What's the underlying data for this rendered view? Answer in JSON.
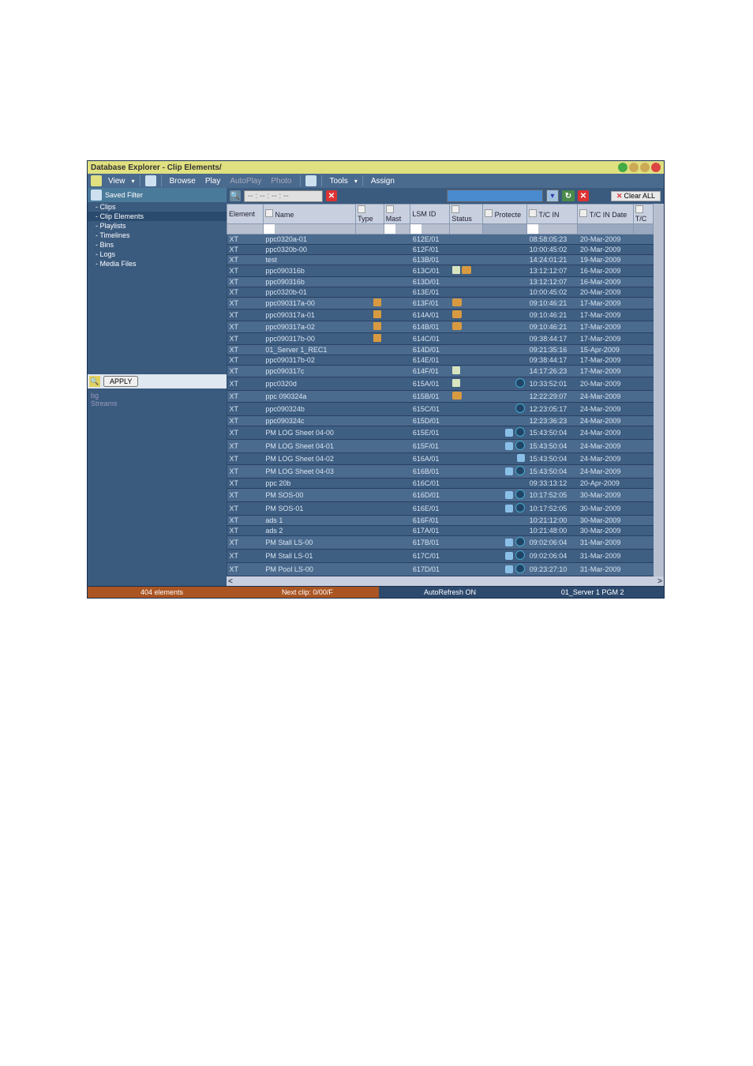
{
  "window": {
    "title": "Database Explorer - Clip Elements/"
  },
  "toolbar": {
    "view": "View",
    "browse": "Browse",
    "play": "Play",
    "autoplay": "AutoPlay",
    "photo": "Photo",
    "tools": "Tools",
    "assign": "Assign"
  },
  "sidebar": {
    "saved_filter": "Saved Filter",
    "items": [
      "- Clips",
      "- Clip Elements",
      "- Playlists",
      "- Timelines",
      "- Bins",
      "- Logs",
      "- Media Files"
    ],
    "apply": "APPLY",
    "bg": "bg",
    "streams": "Streams"
  },
  "search": {
    "placeholder": "-- : -- : -- : --",
    "clear_all": "Clear ALL"
  },
  "columns": {
    "element": "Element",
    "name": "Name",
    "type": "Type",
    "mast": "Mast",
    "lsm_id": "LSM ID",
    "status": "Status",
    "protected": "Protecte",
    "tc_in": "T/C IN",
    "tc_in_date": "T/C IN Date",
    "tc": "T/C"
  },
  "rows": [
    {
      "el": "XT",
      "name": "ppc0320a-01",
      "type": "",
      "lsm": "612E/01",
      "status": "",
      "prot": "",
      "tcin": "08:58:05:23",
      "date": "20-Mar-2009"
    },
    {
      "el": "XT",
      "name": "ppc0320b-00",
      "type": "",
      "lsm": "612F/01",
      "status": "",
      "prot": "",
      "tcin": "10:00:45:02",
      "date": "20-Mar-2009"
    },
    {
      "el": "XT",
      "name": "test",
      "type": "",
      "lsm": "613B/01",
      "status": "",
      "prot": "",
      "tcin": "14:24:01:21",
      "date": "19-Mar-2009"
    },
    {
      "el": "XT",
      "name": "ppc090316b",
      "type": "",
      "lsm": "613C/01",
      "status": "page",
      "prot": "st",
      "tcin": "13:12:12:07",
      "date": "16-Mar-2009"
    },
    {
      "el": "XT",
      "name": "ppc090316b",
      "type": "",
      "lsm": "613D/01",
      "status": "",
      "prot": "",
      "tcin": "13:12:12:07",
      "date": "16-Mar-2009"
    },
    {
      "el": "XT",
      "name": "ppc0320b-01",
      "type": "",
      "lsm": "613E/01",
      "status": "",
      "prot": "",
      "tcin": "10:00:45:02",
      "date": "20-Mar-2009"
    },
    {
      "el": "XT",
      "name": "ppc090317a-00",
      "type": "hi",
      "lsm": "613F/01",
      "status": "",
      "prot": "st",
      "tcin": "09:10:46:21",
      "date": "17-Mar-2009"
    },
    {
      "el": "XT",
      "name": "ppc090317a-01",
      "type": "hi",
      "lsm": "614A/01",
      "status": "",
      "prot": "st",
      "tcin": "09:10:46:21",
      "date": "17-Mar-2009"
    },
    {
      "el": "XT",
      "name": "ppc090317a-02",
      "type": "hi",
      "lsm": "614B/01",
      "status": "",
      "prot": "st",
      "tcin": "09:10:46:21",
      "date": "17-Mar-2009"
    },
    {
      "el": "XT",
      "name": "ppc090317b-00",
      "type": "hi",
      "lsm": "614C/01",
      "status": "",
      "prot": "",
      "tcin": "09:38:44:17",
      "date": "17-Mar-2009"
    },
    {
      "el": "XT",
      "name": "01_Server 1_REC1",
      "type": "",
      "lsm": "614D/01",
      "status": "",
      "prot": "",
      "tcin": "09:21:35:16",
      "date": "15-Apr-2009"
    },
    {
      "el": "XT",
      "name": "ppc090317b-02",
      "type": "",
      "lsm": "614E/01",
      "status": "",
      "prot": "",
      "tcin": "09:38:44:17",
      "date": "17-Mar-2009"
    },
    {
      "el": "XT",
      "name": "ppc090317c",
      "type": "",
      "lsm": "614F/01",
      "status": "page",
      "prot": "",
      "tcin": "14:17:26:23",
      "date": "17-Mar-2009"
    },
    {
      "el": "XT",
      "name": "ppc0320d",
      "type": "",
      "lsm": "615A/01",
      "status": "page",
      "prot": "o",
      "tcin": "10:33:52:01",
      "date": "20-Mar-2009"
    },
    {
      "el": "XT",
      "name": "ppc 090324a",
      "type": "",
      "lsm": "615B/01",
      "status": "",
      "prot": "st",
      "tcin": "12:22:29:07",
      "date": "24-Mar-2009"
    },
    {
      "el": "XT",
      "name": "ppc090324b",
      "type": "",
      "lsm": "615C/01",
      "status": "",
      "prot": "o",
      "tcin": "12:23:05:17",
      "date": "24-Mar-2009"
    },
    {
      "el": "XT",
      "name": "ppc090324c",
      "type": "",
      "lsm": "615D/01",
      "status": "",
      "prot": "",
      "tcin": "12:23:36:23",
      "date": "24-Mar-2009"
    },
    {
      "el": "XT",
      "name": "PM LOG Sheet 04-00",
      "type": "",
      "lsm": "615E/01",
      "status": "",
      "prot": "bo",
      "tcin": "15:43:50:04",
      "date": "24-Mar-2009"
    },
    {
      "el": "XT",
      "name": "PM LOG Sheet 04-01",
      "type": "",
      "lsm": "615F/01",
      "status": "",
      "prot": "bo",
      "tcin": "15:43:50:04",
      "date": "24-Mar-2009"
    },
    {
      "el": "XT",
      "name": "PM LOG Sheet 04-02",
      "type": "",
      "lsm": "616A/01",
      "status": "",
      "prot": "b",
      "tcin": "15:43:50:04",
      "date": "24-Mar-2009"
    },
    {
      "el": "XT",
      "name": "PM LOG Sheet 04-03",
      "type": "",
      "lsm": "616B/01",
      "status": "",
      "prot": "bo",
      "tcin": "15:43:50:04",
      "date": "24-Mar-2009"
    },
    {
      "el": "XT",
      "name": "ppc 20b",
      "type": "",
      "lsm": "616C/01",
      "status": "",
      "prot": "",
      "tcin": "09:33:13:12",
      "date": "20-Apr-2009"
    },
    {
      "el": "XT",
      "name": "PM SOS-00",
      "type": "",
      "lsm": "616D/01",
      "status": "",
      "prot": "bo",
      "tcin": "10:17:52:05",
      "date": "30-Mar-2009"
    },
    {
      "el": "XT",
      "name": "PM SOS-01",
      "type": "",
      "lsm": "616E/01",
      "status": "",
      "prot": "bo",
      "tcin": "10:17:52:05",
      "date": "30-Mar-2009"
    },
    {
      "el": "XT",
      "name": "ads 1",
      "type": "",
      "lsm": "616F/01",
      "status": "",
      "prot": "",
      "tcin": "10:21:12:00",
      "date": "30-Mar-2009"
    },
    {
      "el": "XT",
      "name": "ads 2",
      "type": "",
      "lsm": "617A/01",
      "status": "",
      "prot": "",
      "tcin": "10:21:48:00",
      "date": "30-Mar-2009"
    },
    {
      "el": "XT",
      "name": "PM Stall LS-00",
      "type": "",
      "lsm": "617B/01",
      "status": "",
      "prot": "bo",
      "tcin": "09:02:06:04",
      "date": "31-Mar-2009"
    },
    {
      "el": "XT",
      "name": "PM Stall LS-01",
      "type": "",
      "lsm": "617C/01",
      "status": "",
      "prot": "bo",
      "tcin": "09:02:06:04",
      "date": "31-Mar-2009"
    },
    {
      "el": "XT",
      "name": "PM Pool LS-00",
      "type": "",
      "lsm": "617D/01",
      "status": "",
      "prot": "bo",
      "tcin": "09:23:27:10",
      "date": "31-Mar-2009"
    }
  ],
  "status_bar": {
    "elements": "404 elements",
    "next_clip": "Next clip: 0/00/F",
    "auto_refresh": "AutoRefresh ON",
    "server": "01_Server 1   PGM 2"
  }
}
